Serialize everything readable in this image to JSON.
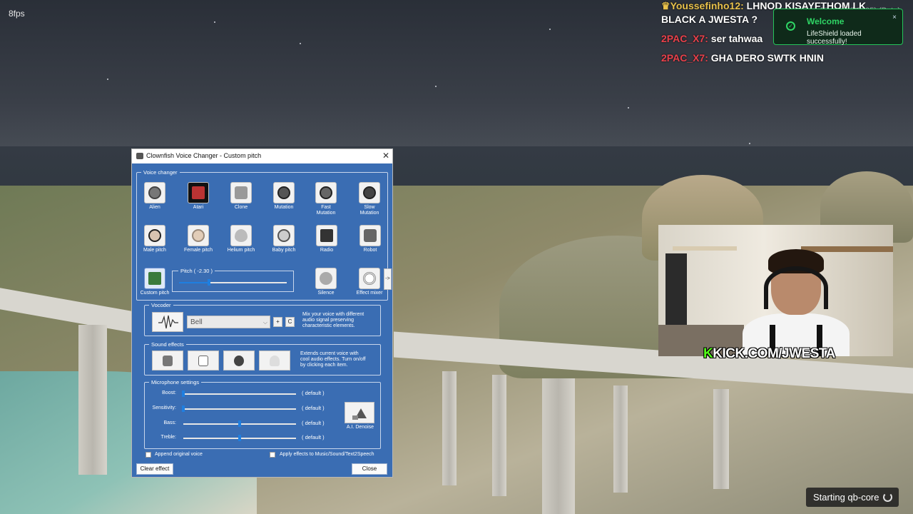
{
  "hud": {
    "fps": "8fps",
    "fivem_version": "FiveM® (b3095) (Beta)",
    "loading_text": "Starting qb-core"
  },
  "chat": [
    {
      "name": "Youssefinho12:",
      "message": "LHNOD KISAYFTHOM LK",
      "name_color": "#e8c14b"
    },
    {
      "name": "",
      "message": "BLACK A JWESTA ?",
      "name_color": "#e8414b"
    },
    {
      "name": "2PAC_X7:",
      "message": "ser tahwaa",
      "name_color": "#e8414b"
    },
    {
      "name": "2PAC_X7:",
      "message": "GHA DERO SWTK HNIN",
      "name_color": "#e8414b"
    }
  ],
  "toast": {
    "title": "Welcome",
    "message": "LifeShield loaded successfully!",
    "close": "×",
    "accent": "#2fd565"
  },
  "stream": {
    "kick_k": "K",
    "kick_url": "KICK.COM/JWESTA"
  },
  "window": {
    "title": "Clownfish Voice Changer - Custom pitch",
    "close": "✕",
    "voice_changer": {
      "label": "Voice changer",
      "items": [
        {
          "label": "Alien",
          "icon": "alien-icon"
        },
        {
          "label": "Atari",
          "icon": "atari-icon"
        },
        {
          "label": "Clone",
          "icon": "clone-icon"
        },
        {
          "label": "Mutation",
          "icon": "mutation-icon"
        },
        {
          "label": "Fast Mutation",
          "icon": "fast-mutation-icon"
        },
        {
          "label": "Slow Mutation",
          "icon": "slow-mutation-icon"
        },
        {
          "label": "Male pitch",
          "icon": "male-pitch-icon"
        },
        {
          "label": "Female pitch",
          "icon": "female-pitch-icon"
        },
        {
          "label": "Helium pitch",
          "icon": "helium-pitch-icon"
        },
        {
          "label": "Baby pitch",
          "icon": "baby-pitch-icon"
        },
        {
          "label": "Radio",
          "icon": "radio-icon"
        },
        {
          "label": "Robot",
          "icon": "robot-icon"
        }
      ],
      "custom_pitch_label": "Custom pitch",
      "pitch_label": "Pitch ( -2.30 )",
      "pitch_position": 0.28,
      "silence_label": "Silence",
      "effect_mixer_label": "Effect mixer",
      "more_arrow": "->"
    },
    "vocoder": {
      "label": "Vocoder",
      "selected": "Bell",
      "add": "+",
      "clear": "C",
      "description": [
        "Mix your voice with different",
        "audio signal preserving",
        "characteristic elements."
      ]
    },
    "sound_effects": {
      "label": "Sound effects",
      "description": [
        "Extends current voice with",
        "cool audio effects. Turn on/off",
        "by clicking each item."
      ]
    },
    "microphone": {
      "label": "Microphone settings",
      "sliders": [
        {
          "label": "Boost:",
          "value": "( default )",
          "position": 0.0
        },
        {
          "label": "Sensitivity:",
          "value": "( default )",
          "position": 0.0
        },
        {
          "label": "Bass:",
          "value": "( default )",
          "position": 0.5
        },
        {
          "label": "Treble:",
          "value": "( default )",
          "position": 0.5
        }
      ],
      "denoise_label": "A.I. Denoise"
    },
    "options": {
      "append_original": "Append original voice",
      "apply_effects": "Apply effects to Music/Sound/Text2Speech"
    },
    "buttons": {
      "clear_effect": "Clear effect",
      "close": "Close"
    }
  }
}
